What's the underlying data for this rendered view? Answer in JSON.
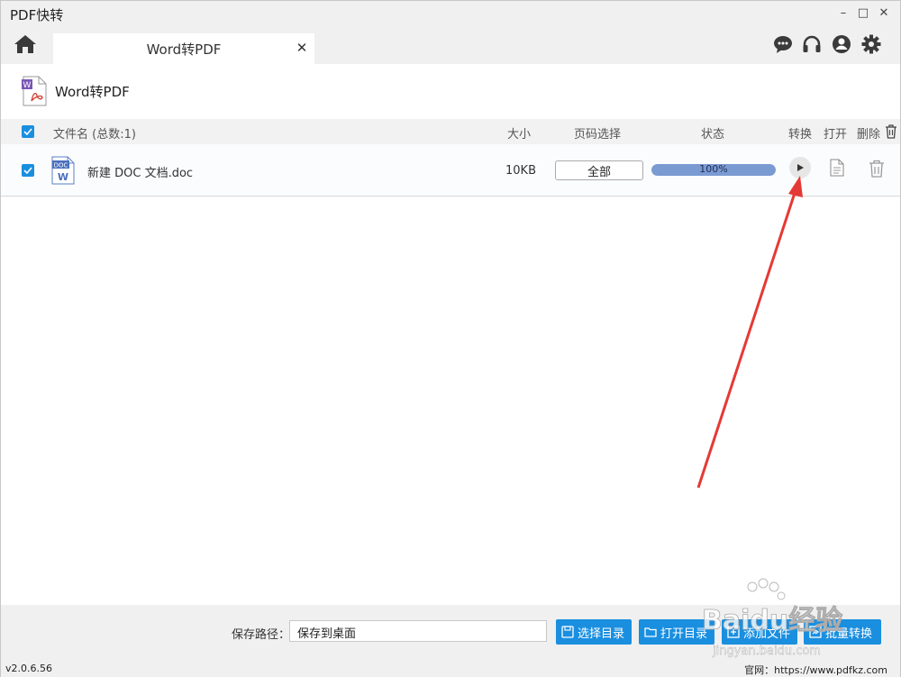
{
  "app": {
    "title": "PDF快转"
  },
  "window_controls": {
    "minimize": "–",
    "maximize": "□",
    "close": "✕"
  },
  "tab": {
    "label": "Word转PDF",
    "close": "✕"
  },
  "top_icons": [
    "chat-icon",
    "headset-icon",
    "user-icon",
    "gear-icon"
  ],
  "section": {
    "title": "Word转PDF"
  },
  "table": {
    "headers": {
      "filename": "文件名 (总数:1)",
      "size": "大小",
      "pages": "页码选择",
      "status": "状态",
      "convert": "转换",
      "open": "打开",
      "delete": "删除"
    },
    "rows": [
      {
        "file_icon_text": "DOC",
        "file_icon_letter": "W",
        "name": "新建 DOC 文档.doc",
        "size": "10KB",
        "pages": "全部",
        "progress_text": "100%",
        "progress": 1.0
      }
    ]
  },
  "bottom": {
    "save_label": "保存路径：",
    "save_value": "保存到桌面",
    "buttons": {
      "choose_dir": "选择目录",
      "open_dir": "打开目录",
      "add_file": "添加文件",
      "batch_convert": "批量转换"
    }
  },
  "status": {
    "version": "v2.0.6.56",
    "site": "官网：https://www.pdfkz.com"
  },
  "watermark": {
    "brand": "Baidu经验",
    "url": "jingyan.baidu.com"
  },
  "colors": {
    "accent": "#1a8fe0",
    "progress": "#7a9ad2",
    "annotation": "#e53935"
  }
}
